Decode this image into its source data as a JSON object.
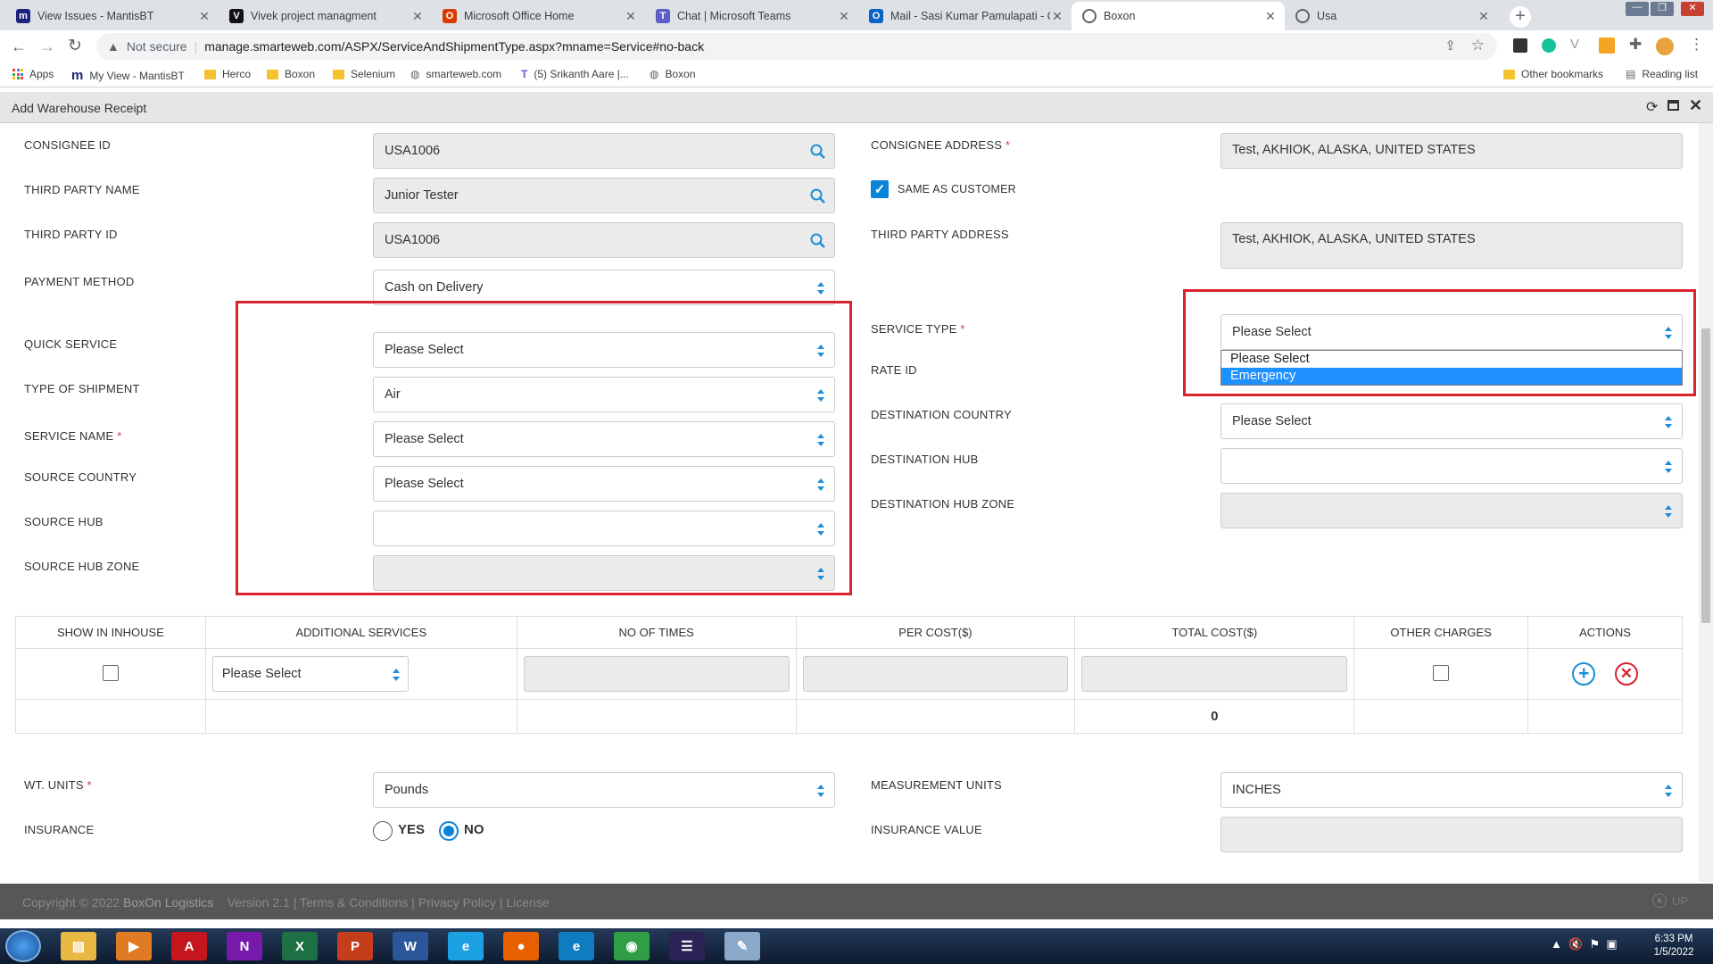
{
  "browser": {
    "tabs": [
      {
        "title": "View Issues - MantisBT",
        "icon": "mantis-icon",
        "color": "#1a237e",
        "glyph": "m"
      },
      {
        "title": "Vivek project managment",
        "icon": "vivek-icon",
        "color": "#111111",
        "glyph": "V"
      },
      {
        "title": "Microsoft Office Home",
        "icon": "office-icon",
        "color": "#d83b01",
        "glyph": "O"
      },
      {
        "title": "Chat | Microsoft Teams",
        "icon": "teams-icon",
        "color": "#5b5fc7",
        "glyph": "T"
      },
      {
        "title": "Mail - Sasi Kumar Pamulapati - O",
        "icon": "outlook-icon",
        "color": "#0a64c8",
        "glyph": "O"
      },
      {
        "title": "Boxon",
        "icon": "globe-icon",
        "color": "#5f6368",
        "glyph": ""
      },
      {
        "title": "Usa",
        "icon": "globe-icon",
        "color": "#5f6368",
        "glyph": ""
      }
    ],
    "active_tab": 5,
    "security_label": "Not secure",
    "url": "manage.smarteweb.com/ASPX/ServiceAndShipmentType.aspx?mname=Service#no-back",
    "bookmarks": [
      "Apps",
      "My View - MantisBT",
      "Herco",
      "Boxon",
      "Selenium",
      "smarteweb.com",
      "(5) Srikanth Aare |...",
      "Boxon"
    ],
    "other_bookmarks": "Other bookmarks",
    "reading_list": "Reading list"
  },
  "app": {
    "window_title": "Add Warehouse Receipt"
  },
  "form": {
    "consignee_id": {
      "label": "CONSIGNEE ID",
      "value": "USA1006"
    },
    "third_party_name": {
      "label": "THIRD PARTY NAME",
      "value": "Junior Tester"
    },
    "third_party_id": {
      "label": "THIRD PARTY ID",
      "value": "USA1006"
    },
    "payment_method": {
      "label": "PAYMENT METHOD",
      "value": "Cash on Delivery"
    },
    "quick_service": {
      "label": "QUICK SERVICE",
      "value": "Please Select"
    },
    "type_of_shipment": {
      "label": "TYPE OF SHIPMENT",
      "value": "Air"
    },
    "service_name": {
      "label": "SERVICE NAME",
      "value": "Please Select"
    },
    "source_country": {
      "label": "SOURCE COUNTRY",
      "value": "Please Select"
    },
    "source_hub": {
      "label": "SOURCE HUB",
      "value": ""
    },
    "source_hub_zone": {
      "label": "SOURCE HUB ZONE",
      "value": ""
    },
    "consignee_address": {
      "label": "CONSIGNEE ADDRESS",
      "value": "Test, AKHIOK, ALASKA, UNITED STATES"
    },
    "same_as_customer": {
      "label": "SAME AS CUSTOMER",
      "checked": true
    },
    "third_party_address": {
      "label": "THIRD PARTY ADDRESS",
      "value": "Test, AKHIOK, ALASKA, UNITED STATES"
    },
    "service_type": {
      "label": "SERVICE TYPE",
      "value": "Please Select",
      "options": [
        "Please Select",
        "Emergency"
      ],
      "highlighted": 1
    },
    "rate_id": {
      "label": "RATE ID"
    },
    "destination_country": {
      "label": "DESTINATION COUNTRY",
      "value": "Please Select"
    },
    "destination_hub": {
      "label": "DESTINATION HUB",
      "value": ""
    },
    "destination_hub_zone": {
      "label": "DESTINATION HUB ZONE",
      "value": ""
    },
    "required_mark": "*"
  },
  "services_table": {
    "headers": [
      "SHOW IN INHOUSE",
      "ADDITIONAL SERVICES",
      "NO OF TIMES",
      "PER COST($)",
      "TOTAL COST($)",
      "OTHER CHARGES",
      "ACTIONS"
    ],
    "row": {
      "additional_service": "Please Select"
    },
    "total": "0"
  },
  "units": {
    "wt_units": {
      "label": "WT. UNITS",
      "value": "Pounds"
    },
    "measurement_units": {
      "label": "MEASUREMENT UNITS",
      "value": "INCHES"
    },
    "insurance": {
      "label": "INSURANCE",
      "yes": "YES",
      "no": "NO",
      "selected": "NO"
    },
    "insurance_value": {
      "label": "INSURANCE VALUE",
      "value": ""
    }
  },
  "footer": {
    "copyright": "Copyright © 2022",
    "company": "BoxOn Logistics",
    "version": "Version 2.1",
    "terms": "Terms & Conditions",
    "privacy": "Privacy Policy",
    "license": "License",
    "up": "UP"
  },
  "taskbar": {
    "time": "6:33 PM",
    "date": "1/5/2022",
    "apps": [
      {
        "name": "explorer-icon",
        "color": "#e8b842",
        "glyph": "▤"
      },
      {
        "name": "media-player-icon",
        "color": "#e07b24",
        "glyph": "▶"
      },
      {
        "name": "acrobat-icon",
        "color": "#c4161c",
        "glyph": "A"
      },
      {
        "name": "onenote-icon",
        "color": "#7719aa",
        "glyph": "N"
      },
      {
        "name": "excel-icon",
        "color": "#1d7044",
        "glyph": "X"
      },
      {
        "name": "powerpoint-icon",
        "color": "#c43e1c",
        "glyph": "P"
      },
      {
        "name": "word-icon",
        "color": "#2b579a",
        "glyph": "W"
      },
      {
        "name": "ie-icon",
        "color": "#1ba1e2",
        "glyph": "e"
      },
      {
        "name": "firefox-icon",
        "color": "#e66000",
        "glyph": "●"
      },
      {
        "name": "edge-icon",
        "color": "#0f7cbf",
        "glyph": "e"
      },
      {
        "name": "chrome-icon",
        "color": "#2f9e44",
        "glyph": "◉"
      },
      {
        "name": "eclipse-icon",
        "color": "#2c2255",
        "glyph": "☰"
      },
      {
        "name": "paint-icon",
        "color": "#8aa9c8",
        "glyph": "✎"
      }
    ]
  },
  "colors": {
    "accent": "#0a84d6",
    "highlight": "#1e90ff",
    "annotation": "#d9232d",
    "danger": "#d9232d"
  }
}
